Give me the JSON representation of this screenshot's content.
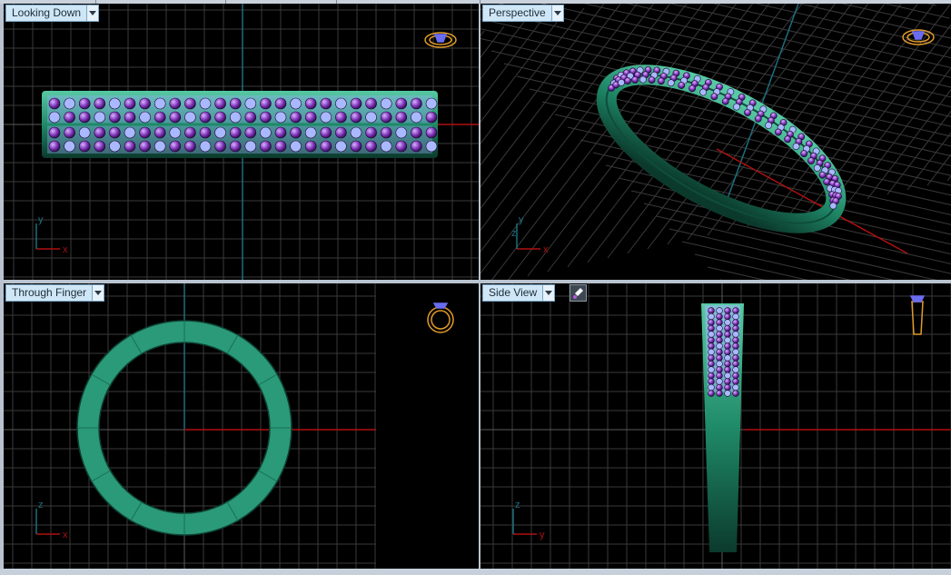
{
  "viewports": {
    "top_left": {
      "label": "Looking Down",
      "view": "top"
    },
    "top_right": {
      "label": "Perspective",
      "view": "perspective"
    },
    "bottom_left": {
      "label": "Through Finger",
      "view": "front"
    },
    "bottom_right": {
      "label": "Side View",
      "view": "side"
    }
  },
  "axes": {
    "top_left": {
      "vertical": "y",
      "horizontal": "x"
    },
    "top_right": {
      "vertical": "y",
      "secondary": "z",
      "horizontal": "x"
    },
    "bottom_left": {
      "vertical": "z",
      "horizontal": "x"
    },
    "bottom_right": {
      "vertical": "z",
      "horizontal": "y"
    }
  },
  "icons": {
    "view_cube": "ring-orientation-icon",
    "tool": "paint-brush-icon",
    "dropdown": "chevron-down-icon"
  },
  "colors": {
    "background": "#000000",
    "grid": "#3a3a3a",
    "grid_major": "#5a5a5a",
    "axis_x": "#b01010",
    "axis_y": "#1c6e7e",
    "band": "#1f8a68",
    "band_light": "#57c9a4",
    "gem_purple": "#7a2fb4",
    "gem_light": "#a9b8ff",
    "label_bg": "#cfe6f6",
    "orientation_icon": "#e39a2a"
  }
}
